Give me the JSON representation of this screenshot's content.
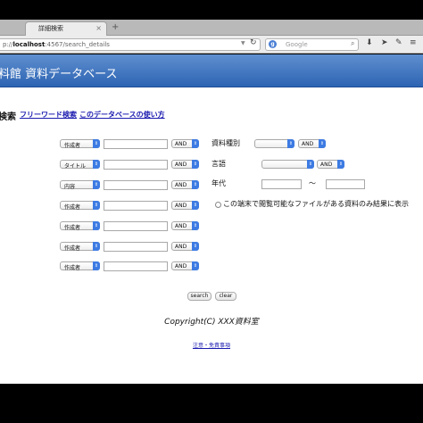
{
  "browser": {
    "tab_title": "詳細検索",
    "tab_close": "×",
    "new_tab": "+",
    "url_prefix": "p://",
    "url_host": "localhost",
    "url_rest": ":4567/search_details",
    "search_placeholder": "Google",
    "search_engine_icon": "google-icon"
  },
  "header": {
    "title": "料館 資料データベース"
  },
  "search": {
    "heading": "検索",
    "freeword_link": "フリーワード検索",
    "howto_link": "このデータベースの使い方",
    "rows": [
      {
        "field": "作成者",
        "op": "AND"
      },
      {
        "field": "タイトル",
        "op": "AND"
      },
      {
        "field": "内容",
        "op": "AND"
      },
      {
        "field": "作成者",
        "op": "AND"
      },
      {
        "field": "作成者",
        "op": "AND"
      },
      {
        "field": "作成者",
        "op": "AND"
      },
      {
        "field": "作成者",
        "op": "AND"
      }
    ],
    "right": {
      "type_label": "資料種別",
      "type_op": "AND",
      "lang_label": "言語",
      "lang_op": "AND",
      "era_label": "年代",
      "era_sep": "〜",
      "radio_label": "この端末で閲覧可能なファイルがある資料のみ結果に表示"
    },
    "search_button": "search",
    "clear_button": "clear"
  },
  "footer": {
    "copyright": "Copyright(C) XXX資料室",
    "notice_link": "注意・免責事項"
  },
  "colors": {
    "banner_top": "#5f8fcf",
    "banner_bottom": "#2d64b3",
    "link": "#1a1ab0",
    "select_arrow": "#3d7be3"
  }
}
